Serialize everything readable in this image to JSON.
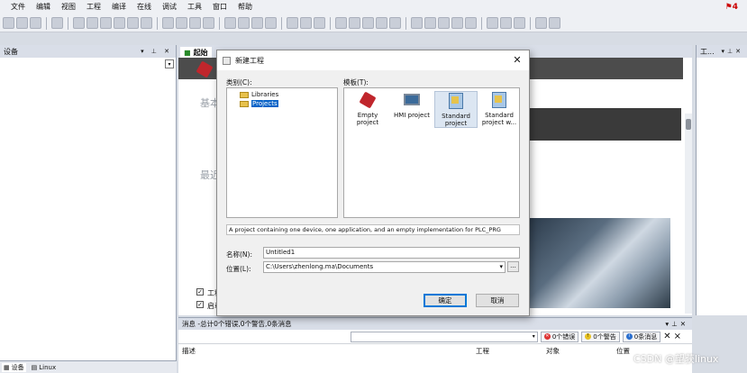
{
  "menu": [
    "文件",
    "编辑",
    "视图",
    "工程",
    "编译",
    "在线",
    "调试",
    "工具",
    "窗口",
    "帮助"
  ],
  "flag": {
    "count": "4"
  },
  "left_panel": {
    "title": "设备",
    "controls": "▾ ⊥ ✕"
  },
  "bottom_tabs": {
    "devices": "设备",
    "linux": "Linux"
  },
  "center": {
    "tab_label": "起始",
    "text_basic": "基本",
    "text_recent": "最近",
    "check_1": "工程",
    "check_2": "启动"
  },
  "right_panel": {
    "title": "工..."
  },
  "messages": {
    "header": "消息 -总计0个错误,0个警告,0条消息",
    "errors": "0个错误",
    "warnings": "0个警告",
    "info": "0条消息",
    "columns": {
      "description": "描述",
      "project": "工程",
      "object": "对象",
      "position": "位置"
    }
  },
  "dialog": {
    "title": "新建工程",
    "category_label": "类别(C):",
    "template_label": "模板(T):",
    "categories": [
      "Libraries",
      "Projects"
    ],
    "selected_category": "Projects",
    "templates": [
      {
        "label": "Empty project",
        "icon": "empty-project-icon"
      },
      {
        "label": "HMI project",
        "icon": "hmi-project-icon"
      },
      {
        "label": "Standard project",
        "icon": "standard-project-icon"
      },
      {
        "label": "Standard project w...",
        "icon": "standard-project-with-application-icon"
      }
    ],
    "description": "A project containing one device, one application, and an empty implementation for PLC_PRG",
    "name_label": "名称(N):",
    "name_value": "Untitled1",
    "location_label": "位置(L):",
    "location_value": "C:\\Users\\zhenlong.ma\\Documents",
    "browse_label": "...",
    "ok_label": "确定",
    "cancel_label": "取消"
  },
  "watermark": "CSDN @望获linux",
  "colors": {
    "selection": "#0a64c8",
    "banner": "#4c4c4c",
    "logo_red": "#c0262c"
  }
}
